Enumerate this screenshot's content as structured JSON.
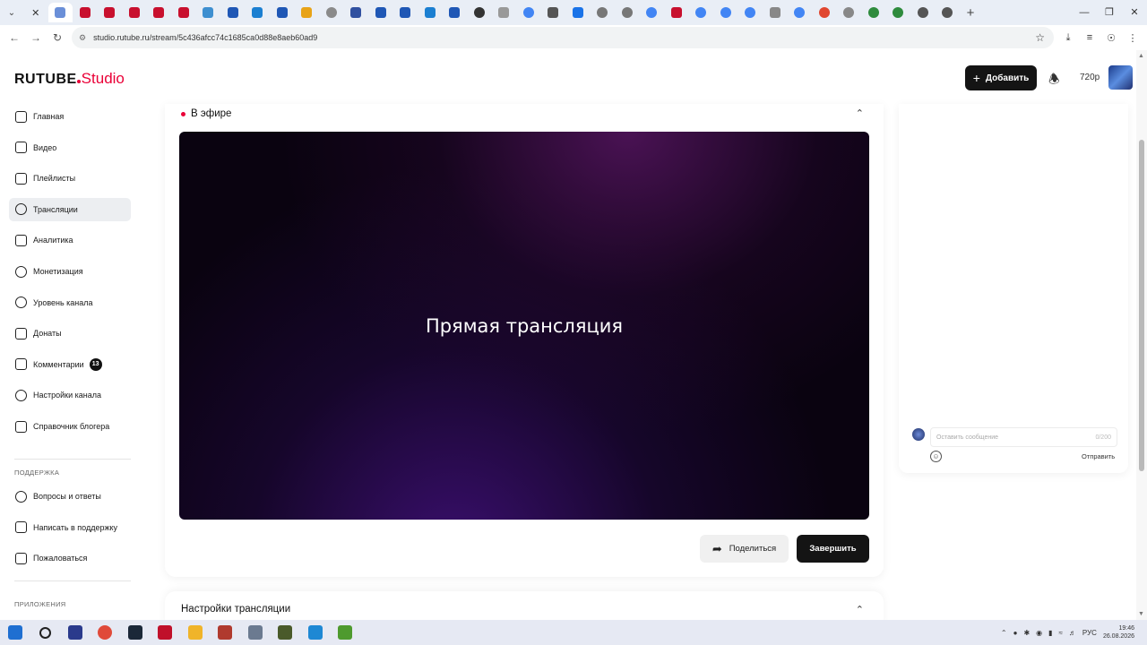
{
  "browser": {
    "url": "studio.rutube.ru/stream/5c436afcc74c1685ca0d88e8aeb60ad9",
    "tabs": [
      {
        "color": "#d9534f",
        "kind": "x"
      },
      {
        "color": "#6a8fd8"
      },
      {
        "color": "#c8102e"
      },
      {
        "color": "#c8102e"
      },
      {
        "color": "#c8102e"
      },
      {
        "color": "#c8102e"
      },
      {
        "color": "#c8102e"
      },
      {
        "color": "#3e8fd0"
      },
      {
        "color": "#1f57b5"
      },
      {
        "color": "#1b7fd1"
      },
      {
        "color": "#1f57b5"
      },
      {
        "color": "#e8a317"
      },
      {
        "color": "#8a8a8a",
        "round": true
      },
      {
        "color": "#3050a0"
      },
      {
        "color": "#1f57b5"
      },
      {
        "color": "#1f57b5"
      },
      {
        "color": "#1b7fd1"
      },
      {
        "color": "#1f57b5"
      },
      {
        "color": "#333333",
        "round": true
      },
      {
        "color": "#999999"
      },
      {
        "color": "#4285f4",
        "round": true
      },
      {
        "color": "#555555"
      },
      {
        "color": "#1a73e8"
      },
      {
        "color": "#777777",
        "round": true
      },
      {
        "color": "#777777",
        "round": true
      },
      {
        "color": "#4285f4",
        "round": true
      },
      {
        "color": "#c8102e"
      },
      {
        "color": "#4285f4",
        "round": true
      },
      {
        "color": "#4285f4",
        "round": true
      },
      {
        "color": "#4285f4",
        "round": true
      },
      {
        "color": "#888888"
      },
      {
        "color": "#4285f4",
        "round": true
      },
      {
        "color": "#e0462f",
        "round": true
      },
      {
        "color": "#888888",
        "round": true
      },
      {
        "color": "#2e8b3d",
        "round": true
      },
      {
        "color": "#2e8b3d",
        "round": true
      },
      {
        "color": "#555555",
        "round": true
      },
      {
        "color": "#555555",
        "round": true
      }
    ]
  },
  "header": {
    "logo_text": "RUTUBE",
    "logo_studio": "Studio",
    "add_button": "Добавить",
    "quality": "720p"
  },
  "sidebar": {
    "items": [
      {
        "label": "Главная",
        "icon": "home-icon"
      },
      {
        "label": "Видео",
        "icon": "video-icon"
      },
      {
        "label": "Плейлисты",
        "icon": "playlist-icon"
      },
      {
        "label": "Трансляции",
        "icon": "broadcast-icon",
        "active": true
      },
      {
        "label": "Аналитика",
        "icon": "analytics-icon"
      },
      {
        "label": "Монетизация",
        "icon": "ruble-icon"
      },
      {
        "label": "Уровень канала",
        "icon": "star-icon"
      },
      {
        "label": "Донаты",
        "icon": "donate-icon"
      },
      {
        "label": "Комментарии",
        "icon": "comments-icon",
        "badge": "13"
      },
      {
        "label": "Настройки канала",
        "icon": "gear-icon"
      },
      {
        "label": "Справочник блогера",
        "icon": "book-icon"
      }
    ],
    "support_label": "ПОДДЕРЖКА",
    "support_items": [
      {
        "label": "Вопросы и ответы",
        "icon": "faq-icon"
      },
      {
        "label": "Написать в поддержку",
        "icon": "mail-icon"
      },
      {
        "label": "Пожаловаться",
        "icon": "flag-icon"
      }
    ],
    "apps_label": "ПРИЛОЖЕНИЯ"
  },
  "stream": {
    "status": "В эфире",
    "player_title": "Прямая трансляция",
    "share_button": "Поделиться",
    "end_button": "Завершить",
    "settings_title": "Настройки трансляции"
  },
  "chat": {
    "placeholder": "Оставить сообщение",
    "counter": "0/200",
    "send_button": "Отправить"
  },
  "taskbar": {
    "apps": [
      {
        "name": "windows-start-icon",
        "color": "#1f6fd1"
      },
      {
        "name": "search-icon",
        "color": "#222222"
      },
      {
        "name": "app-icon",
        "color": "#2a3a8c"
      },
      {
        "name": "chrome-icon",
        "color": "#e04a3a"
      },
      {
        "name": "steam-icon",
        "color": "#1b2838"
      },
      {
        "name": "app-icon",
        "color": "#c0102a"
      },
      {
        "name": "folder-icon",
        "color": "#f0b429"
      },
      {
        "name": "app-icon",
        "color": "#b03a2e"
      },
      {
        "name": "settings-icon",
        "color": "#6b7a90"
      },
      {
        "name": "app-icon",
        "color": "#4a5a2a"
      },
      {
        "name": "vscode-icon",
        "color": "#1e88d4"
      },
      {
        "name": "minecraft-icon",
        "color": "#4e9a2e"
      }
    ],
    "language": "РУС",
    "time": "19:46",
    "date": "26.08.2026"
  }
}
